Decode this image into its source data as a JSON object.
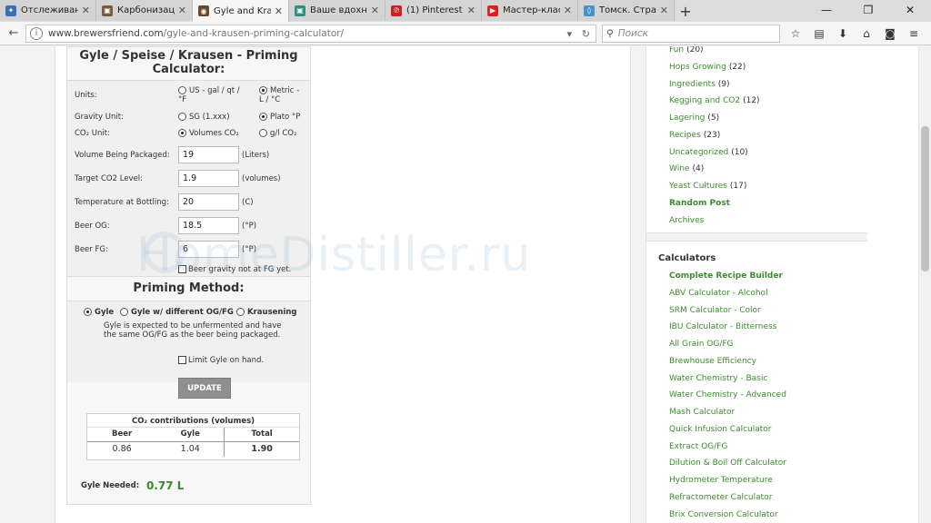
{
  "browser": {
    "tabs": [
      {
        "title": "Отслеживан...",
        "color": "#3b6fb6",
        "glyph": "✦"
      },
      {
        "title": "Карбонизац...",
        "color": "#7a5a3a",
        "glyph": "▣"
      },
      {
        "title": "Gyle and Kra...",
        "color": "#6a4a2a",
        "glyph": "◉",
        "active": true
      },
      {
        "title": "Ваше вдохно...",
        "color": "#2f8f7f",
        "glyph": "▣"
      },
      {
        "title": "(1) Pinterest •...",
        "color": "#cb2027",
        "glyph": "℗"
      },
      {
        "title": "Мастер-клас...",
        "color": "#e02020",
        "glyph": "▶"
      },
      {
        "title": "Томск. Стра...",
        "color": "#4a90c8",
        "glyph": "◊"
      }
    ],
    "url_domain": "www.brewersfriend.com",
    "url_path": "/gyle-and-krausen-priming-calculator/",
    "search_placeholder": "Поиск"
  },
  "calculator": {
    "title": "Gyle / Speise / Krausen - Priming Calculator:",
    "units_label": "Units:",
    "units_options": [
      "US - gal / qt / °F",
      "Metric - L / °C"
    ],
    "gravity_label": "Gravity Unit:",
    "gravity_options": [
      "SG (1.xxx)",
      "Plato °P"
    ],
    "co2_label": "CO₂ Unit:",
    "co2_options": [
      "Volumes CO₂",
      "g/l CO₂"
    ],
    "fields": [
      {
        "label": "Volume Being Packaged:",
        "value": "19",
        "unit": "(Liters)"
      },
      {
        "label": "Target CO2 Level:",
        "value": "1.9",
        "unit": "(volumes)"
      },
      {
        "label": "Temperature at Bottling:",
        "value": "20",
        "unit": "(C)"
      },
      {
        "label": "Beer OG:",
        "value": "18.5",
        "unit": "(°P)"
      },
      {
        "label": "Beer FG:",
        "value": "6",
        "unit": "(°P)"
      }
    ],
    "fg_check": "Beer gravity not at FG yet.",
    "priming_title": "Priming Method:",
    "methods": [
      "Gyle",
      "Gyle w/ different OG/FG",
      "Krausening"
    ],
    "method_desc": "Gyle is expected to be unfermented and have the same OG/FG as the beer being packaged.",
    "limit_check": "Limit Gyle on hand.",
    "update_label": "UPDATE",
    "table_caption": "CO₂ contributions (volumes)",
    "table_headers": [
      "Beer",
      "Gyle",
      "Total"
    ],
    "table_values": [
      "0.86",
      "1.04",
      "1.90"
    ],
    "gyle_needed_label": "Gyle Needed:",
    "gyle_needed_value": "0.77 L"
  },
  "sidebar": {
    "categories": [
      {
        "name": "Fun",
        "count": "(20)"
      },
      {
        "name": "Hops Growing",
        "count": "(22)"
      },
      {
        "name": "Ingredients",
        "count": "(9)"
      },
      {
        "name": "Kegging and CO2",
        "count": "(12)"
      },
      {
        "name": "Lagering",
        "count": "(5)"
      },
      {
        "name": "Recipes",
        "count": "(23)"
      },
      {
        "name": "Uncategorized",
        "count": "(10)"
      },
      {
        "name": "Wine",
        "count": "(4)"
      },
      {
        "name": "Yeast Cultures",
        "count": "(17)"
      },
      {
        "name": "Random Post",
        "count": ""
      },
      {
        "name": "Archives",
        "count": ""
      }
    ],
    "calculators_heading": "Calculators",
    "calculators": [
      "Complete Recipe Builder",
      "ABV Calculator - Alcohol",
      "SRM Calculator - Color",
      "IBU Calculator - Bitterness",
      "All Grain OG/FG",
      "Brewhouse Efficiency",
      "Water Chemistry - Basic",
      "Water Chemistry - Advanced",
      "Mash Calculator",
      "Quick Infusion Calculator",
      "Extract OG/FG",
      "Dilution & Boil Off Calculator",
      "Hydrometer Temperature",
      "Refractometer Calculator",
      "Brix Conversion Calculator"
    ]
  },
  "watermark": "HomeDistiller.ru"
}
